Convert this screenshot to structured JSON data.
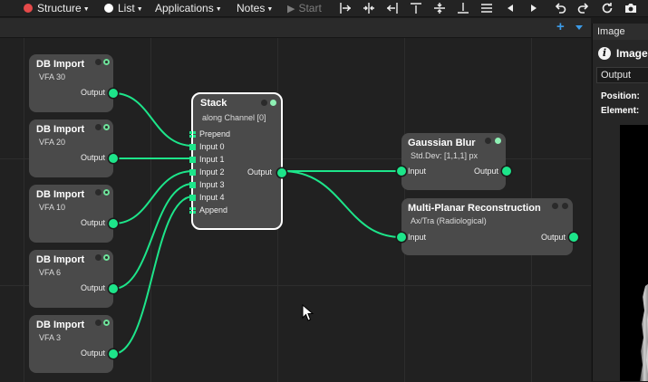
{
  "toolbar": {
    "menus": [
      {
        "label": "Structure",
        "icon": "red-dot-icon"
      },
      {
        "label": "List",
        "icon": "white-dot-icon"
      },
      {
        "label": "Applications"
      },
      {
        "label": "Notes"
      }
    ],
    "start_label": "Start",
    "accent_color": "#3c9be8"
  },
  "graph": {
    "db_imports": [
      {
        "title": "DB Import",
        "subtitle": "VFA 30",
        "output": "Output"
      },
      {
        "title": "DB Import",
        "subtitle": "VFA 20",
        "output": "Output"
      },
      {
        "title": "DB Import",
        "subtitle": "VFA 10",
        "output": "Output"
      },
      {
        "title": "DB Import",
        "subtitle": "VFA 6",
        "output": "Output"
      },
      {
        "title": "DB Import",
        "subtitle": "VFA 3",
        "output": "Output"
      }
    ],
    "stack": {
      "title": "Stack",
      "subtitle": "along Channel [0]",
      "inputs": [
        "Prepend",
        "Input 0",
        "Input 1",
        "Input 2",
        "Input 3",
        "Input 4",
        "Append"
      ],
      "output": "Output"
    },
    "gaussian": {
      "title": "Gaussian Blur",
      "subtitle": "Std.Dev: [1,1,1] px",
      "input": "Input",
      "output": "Output"
    },
    "mpr": {
      "title": "Multi-Planar Reconstruction",
      "subtitle": "Ax/Tra (Radiological)",
      "input": "Input",
      "output": "Output"
    },
    "wire_color": "#1de58a"
  },
  "panel": {
    "tab_label": "Image",
    "header_title": "Image",
    "output_select": "Output",
    "position_label": "Position:",
    "element_label": "Element:"
  }
}
